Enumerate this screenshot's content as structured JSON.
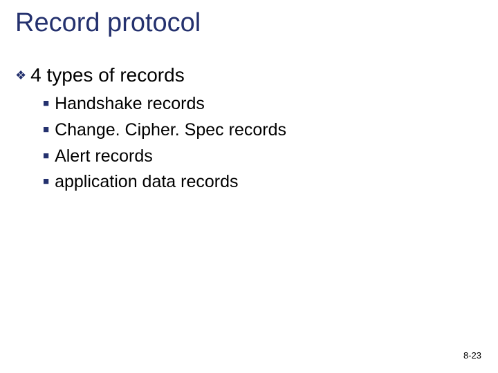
{
  "slide": {
    "title": "Record protocol",
    "main_bullet": "4 types of records",
    "sub_items": [
      "Handshake records",
      "Change. Cipher. Spec records",
      "Alert records",
      "application data records"
    ],
    "page_number": "8-23"
  }
}
